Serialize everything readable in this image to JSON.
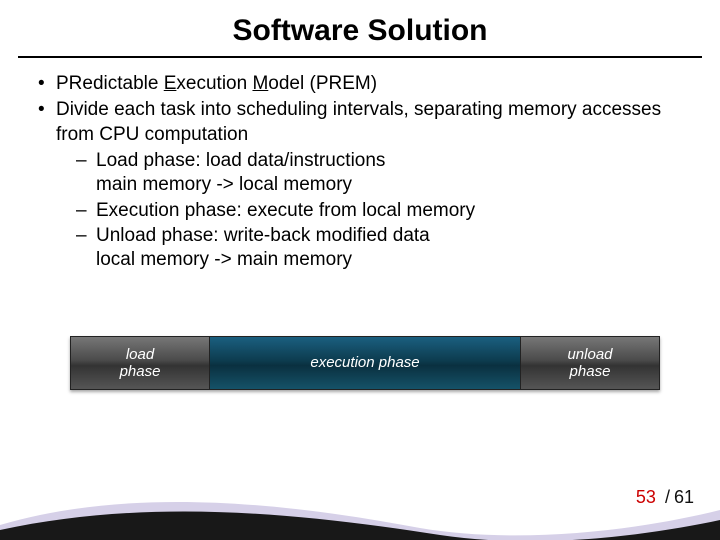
{
  "title": "Software Solution",
  "bullets": {
    "b1_pre": "PRedictable ",
    "b1_u": "E",
    "b1_mid": "xecution ",
    "b1_u2": "M",
    "b1_post": "odel (PREM)",
    "b2": "Divide each task into scheduling intervals, separating memory accesses from CPU computation",
    "s1a": "Load phase: load data/instructions",
    "s1b": "main memory -> local memory",
    "s2": "Execution phase: execute from local memory",
    "s3a": "Unload phase: write-back modified data",
    "s3b": "local memory -> main memory"
  },
  "phases": {
    "load": "load\nphase",
    "exec": "execution phase",
    "unload": "unload\nphase"
  },
  "page": {
    "current": "53",
    "sep": "/",
    "total": "61"
  }
}
